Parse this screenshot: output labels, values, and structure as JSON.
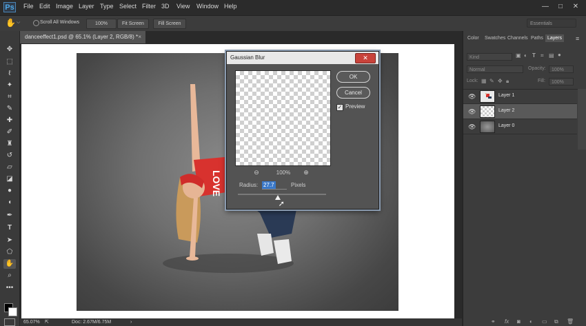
{
  "app": {
    "logo": "Ps"
  },
  "menu": [
    "File",
    "Edit",
    "Image",
    "Layer",
    "Type",
    "Select",
    "Filter",
    "3D",
    "View",
    "Window",
    "Help"
  ],
  "window_controls": {
    "minimize": "—",
    "maximize": "□",
    "close": "✕"
  },
  "options_bar": {
    "scroll_all_windows": "Scroll All Windows",
    "zoom_value": "100%",
    "fit_screen": "Fit Screen",
    "fill_screen": "Fill Screen",
    "workspace": "Essentials"
  },
  "tools": [
    "move-tool-icon",
    "marquee-tool-icon",
    "lasso-tool-icon",
    "magic-wand-tool-icon",
    "crop-tool-icon",
    "eyedropper-tool-icon",
    "healing-brush-tool-icon",
    "brush-tool-icon",
    "clone-stamp-tool-icon",
    "history-brush-tool-icon",
    "eraser-tool-icon",
    "paint-bucket-tool-icon",
    "blur-tool-icon",
    "dodge-tool-icon",
    "pen-tool-icon",
    "type-tool-icon",
    "path-selection-tool-icon",
    "shape-tool-icon",
    "hand-tool-icon",
    "zoom-tool-icon",
    "more-tools-icon"
  ],
  "document": {
    "tab_title": "danceeffect1.psd @ 65.1% (Layer 2, RGB/8) *",
    "tab_close": "×",
    "shirt_text": "LOVE"
  },
  "status": {
    "zoom": "65.07%",
    "doc_info": "Doc: 2.67M/6.75M"
  },
  "dialog": {
    "title": "Gaussian Blur",
    "close": "✕",
    "ok": "OK",
    "cancel": "Cancel",
    "preview_label": "Preview",
    "preview_checked": "✓",
    "zoom_out": "⊖",
    "zoom_in": "⊕",
    "zoom_level": "100%",
    "radius_label": "Radius:",
    "radius_value": "27.7",
    "unit": "Pixels",
    "slider_position": 0.45
  },
  "panel": {
    "tabs": [
      "Color",
      "Swatches",
      "Channels",
      "Paths",
      "Layers"
    ],
    "active_tab": "Layers",
    "search_placeholder": "Kind",
    "blend_mode": "Normal",
    "opacity_label": "Opacity:",
    "opacity_value": "100%",
    "lock_label": "Lock:",
    "fill_label": "Fill:",
    "fill_value": "100%",
    "layers": [
      {
        "name": "Layer 1",
        "visible": true,
        "selected": false,
        "thumb": "dancer"
      },
      {
        "name": "Layer 2",
        "visible": true,
        "selected": true,
        "thumb": "checker"
      },
      {
        "name": "Layer 0",
        "visible": true,
        "selected": false,
        "thumb": "gradient"
      }
    ],
    "bottom_icons": [
      "link-icon",
      "fx-icon",
      "mask-icon",
      "adjustment-icon",
      "folder-icon",
      "new-layer-icon",
      "trash-icon"
    ]
  },
  "colors": {
    "accent_blue": "#3a78c8",
    "close_red": "#c8433b",
    "shirt_red": "#d8322e",
    "jeans_blue": "#2a3a55"
  }
}
